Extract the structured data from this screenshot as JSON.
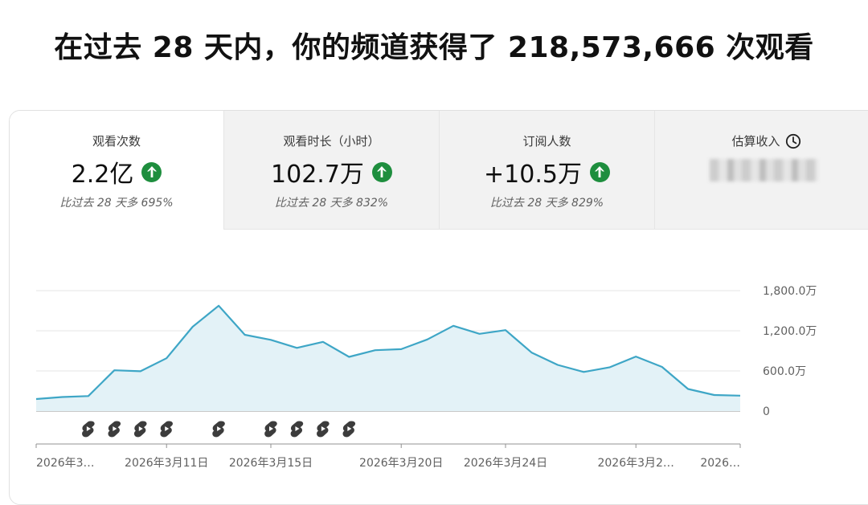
{
  "headline": "在过去 28 天内，你的频道获得了 218,573,666 次观看",
  "tabs": [
    {
      "label": "观看次数",
      "value": "2.2亿",
      "compare": "比过去 28 天多 695%",
      "trend": "up"
    },
    {
      "label": "观看时长（小时）",
      "value": "102.7万",
      "compare": "比过去 28 天多 832%",
      "trend": "up"
    },
    {
      "label": "订阅人数",
      "value": "+10.5万",
      "compare": "比过去 28 天多 829%",
      "trend": "up"
    },
    {
      "label": "估算收入",
      "value": "",
      "compare": "",
      "icon": "clock-icon",
      "value_hidden": true
    }
  ],
  "colors": {
    "line": "#3ea6c6",
    "area": "#e3f2f7",
    "up": "#1e8e3e"
  },
  "chart_data": {
    "type": "area",
    "x": [
      "2026年3…",
      "",
      "",
      "",
      "",
      "2026年3月11日",
      "",
      "",
      "",
      "2026年3月15日",
      "",
      "",
      "",
      "",
      "2026年3月20日",
      "",
      "",
      "",
      "2026年3月24日",
      "",
      "",
      "",
      "",
      "2026年3月2…",
      "",
      "",
      "",
      "2026…"
    ],
    "series": [
      {
        "values": [
          180,
          210,
          225,
          610,
          595,
          790,
          1260,
          1575,
          1140,
          1065,
          945,
          1035,
          810,
          910,
          925,
          1070,
          1275,
          1155,
          1210,
          875,
          690,
          585,
          655,
          815,
          660,
          330,
          240,
          230
        ]
      }
    ],
    "y_ticks": [
      "1,800.0万",
      "1,200.0万",
      "600.0万",
      "0"
    ],
    "ylim": [
      0,
      1800
    ],
    "x_tick_labels": [
      "2026年3…",
      "2026年3月11日",
      "2026年3月15日",
      "2026年3月20日",
      "2026年3月24日",
      "2026年3月2…",
      "2026…"
    ],
    "x_tick_indices": [
      0,
      5,
      9,
      14,
      18,
      23,
      27
    ],
    "shorts_markers": [
      2,
      3,
      4,
      5,
      7,
      9,
      10,
      11,
      12
    ],
    "grid": true
  }
}
